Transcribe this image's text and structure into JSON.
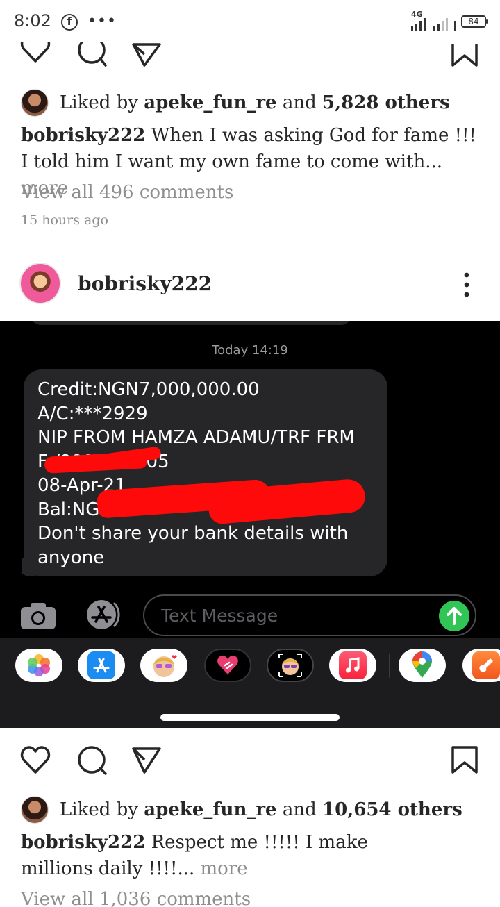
{
  "status_bar": {
    "time": "8:02",
    "network": "4G",
    "battery": "84",
    "icons": [
      "facebook-icon",
      "more-notifications-icon",
      "signal-icon",
      "battery-icon"
    ]
  },
  "post1": {
    "liked_by_prefix": "Liked by",
    "liked_by_user": "apeke_fun_re",
    "liked_by_and": "and",
    "liked_by_others": "5,828 others",
    "caption_user": "bobrisky222",
    "caption_text": "When I was asking God for fame !!! I told him I want my own fame to come with...",
    "more": "more",
    "view_comments_prefix": "View all",
    "view_comments_count": "496 comments",
    "time_ago": "15 hours ago"
  },
  "post2": {
    "username": "bobrisky222",
    "screenshot": {
      "timestamp": "Today 14:19",
      "message_lines": [
        "Credit:NGN7,000,000.00",
        "A/C:***2929",
        "NIP FROM HAMZA  ADAMU/TRF FRM",
        "F              /000004/005",
        "08-Apr-21",
        "Bal:NG",
        "Don't share your bank details with",
        "anyone"
      ],
      "compose_placeholder": "Text Message",
      "redaction_color": "#ff0a0a",
      "send_color": "#30c554",
      "drawer_apps": [
        "photos-app-icon",
        "app-store-app-icon",
        "memoji-app-icon",
        "digital-touch-app-icon",
        "animoji-app-icon",
        "music-app-icon",
        "maps-app-icon",
        "garageband-app-icon"
      ]
    },
    "liked_by_prefix": "Liked by",
    "liked_by_user": "apeke_fun_re",
    "liked_by_and": "and",
    "liked_by_others": "10,654 others",
    "caption_user": "bobrisky222",
    "caption_text": "Respect me !!!!! I make millions daily !!!!...",
    "more": "more",
    "view_comments_prefix": "View all",
    "view_comments_count": "1,036 comments"
  }
}
